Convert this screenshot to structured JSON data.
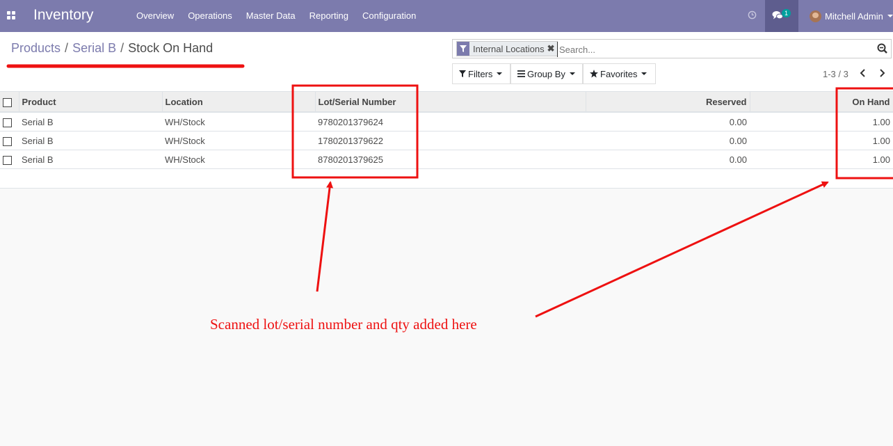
{
  "navbar": {
    "app_title": "Inventory",
    "menu": [
      "Overview",
      "Operations",
      "Master Data",
      "Reporting",
      "Configuration"
    ],
    "chat_count": "1",
    "user_name": "Mitchell Admin",
    "color": "#7c7bad"
  },
  "breadcrumb": {
    "items": [
      "Products",
      "Serial B"
    ],
    "current": "Stock On Hand"
  },
  "search": {
    "facet_label": "Internal Locations",
    "placeholder": "Search..."
  },
  "buttons": {
    "filters": "Filters",
    "group_by": "Group By",
    "favorites": "Favorites"
  },
  "pager": "1-3 / 3",
  "table": {
    "columns": [
      "Product",
      "Location",
      "Lot/Serial Number",
      "Reserved",
      "On Hand"
    ],
    "rows": [
      {
        "product": "Serial B",
        "location": "WH/Stock",
        "lot": "9780201379624",
        "reserved": "0.00",
        "on_hand": "1.00"
      },
      {
        "product": "Serial B",
        "location": "WH/Stock",
        "lot": "1780201379622",
        "reserved": "0.00",
        "on_hand": "1.00"
      },
      {
        "product": "Serial B",
        "location": "WH/Stock",
        "lot": "8780201379625",
        "reserved": "0.00",
        "on_hand": "1.00"
      }
    ]
  },
  "annotation": {
    "note": "Scanned lot/serial number and qty added here",
    "color": "#ee1111"
  }
}
